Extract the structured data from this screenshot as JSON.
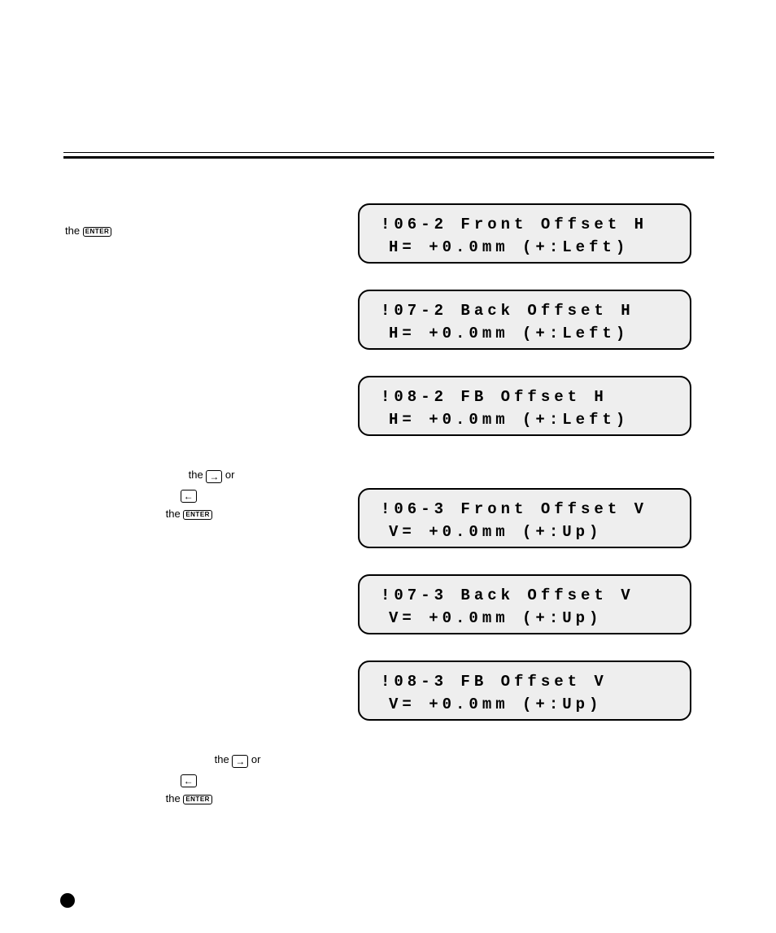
{
  "steps": {
    "s1_prefix": "the ",
    "s1_enter": "ENTER",
    "s2_line1_a": "the ",
    "s2_line1_b": " or",
    "s2_line2_a": "",
    "s2_line3_a": "the ",
    "s2_line3_enter": "ENTER",
    "s3_line1_a": "the ",
    "s3_line1_b": " or",
    "s3_line3_a": "the ",
    "s3_line3_enter": "ENTER",
    "arrow_right": "→",
    "arrow_left": "←"
  },
  "lcds": [
    {
      "line1": "!06-2 Front Offset H",
      "line2": "H= +0.0mm (+:Left)"
    },
    {
      "line1": "!07-2 Back Offset H",
      "line2": "H= +0.0mm (+:Left)"
    },
    {
      "line1": "!08-2 FB Offset H",
      "line2": "H= +0.0mm (+:Left)"
    },
    {
      "line1": "!06-3 Front Offset V",
      "line2": "V= +0.0mm (+:Up)"
    },
    {
      "line1": "!07-3 Back Offset V",
      "line2": "V= +0.0mm (+:Up)"
    },
    {
      "line1": "!08-3 FB Offset V",
      "line2": "V= +0.0mm (+:Up)"
    }
  ]
}
